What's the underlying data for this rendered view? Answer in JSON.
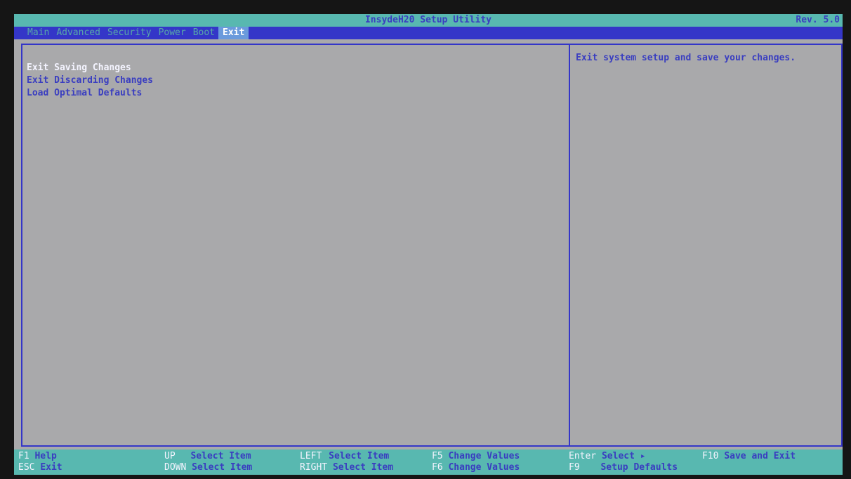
{
  "header": {
    "title": "InsydeH20 Setup Utility",
    "revision": "Rev. 5.0"
  },
  "menu": {
    "tabs": [
      {
        "label": "Main"
      },
      {
        "label": "Advanced"
      },
      {
        "label": "Security"
      },
      {
        "label": "Power"
      },
      {
        "label": "Boot"
      },
      {
        "label": "Exit"
      }
    ],
    "active": "Exit"
  },
  "main": {
    "options": [
      {
        "label": "Exit Saving Changes"
      },
      {
        "label": "Exit Discarding Changes"
      },
      {
        "label": "Load Optimal Defaults"
      }
    ],
    "selected": "Exit Saving Changes",
    "help": "Exit system setup and save your changes."
  },
  "footer": {
    "row1": [
      {
        "key": "F1",
        "desc": "Help"
      },
      {
        "key": "UP",
        "desc": "Select Item"
      },
      {
        "key": "LEFT",
        "desc": "Select Item"
      },
      {
        "key": "F5",
        "desc": "Change Values"
      },
      {
        "key": "Enter",
        "desc": "Select ▸"
      },
      {
        "key": "F10",
        "desc": "Save and Exit"
      }
    ],
    "row2": [
      {
        "key": "ESC",
        "desc": "Exit"
      },
      {
        "key": "DOWN",
        "desc": "Select Item"
      },
      {
        "key": "RIGHT",
        "desc": "Select Item"
      },
      {
        "key": "F6",
        "desc": "Change Values"
      },
      {
        "key": "F9",
        "desc": "Setup Defaults"
      }
    ]
  },
  "colors": {
    "background": "#a9a9ab",
    "title_bar": "#58b8b0",
    "menu_bar": "#3436c8",
    "text": "#3a3ec0",
    "highlight": "#f4f4ff",
    "active_tab": "#6a9adc"
  }
}
